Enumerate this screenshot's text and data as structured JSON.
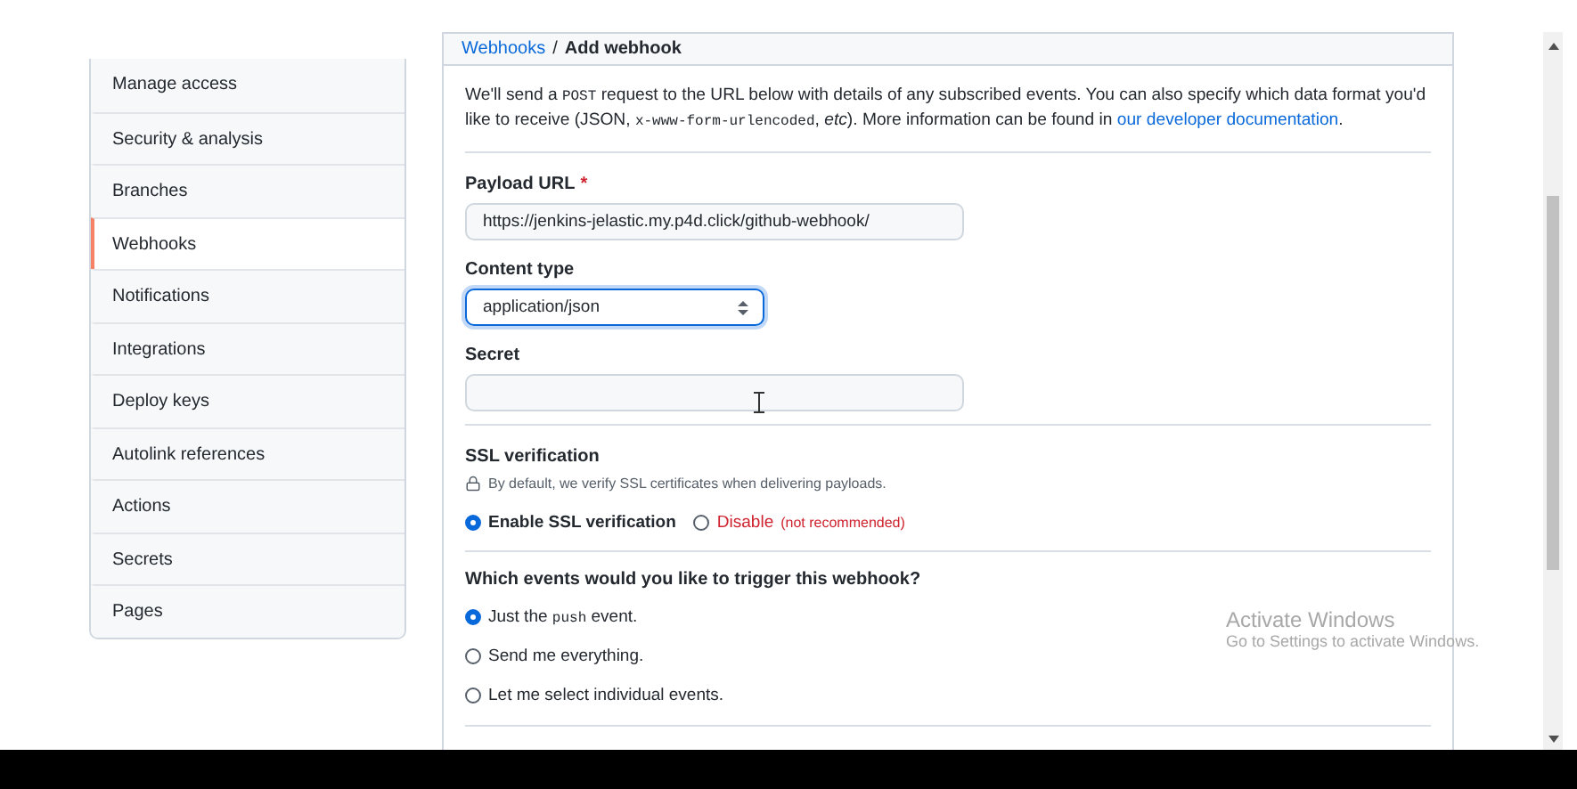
{
  "sidebar": {
    "items": [
      {
        "label": "Manage access",
        "selected": false
      },
      {
        "label": "Security & analysis",
        "selected": false
      },
      {
        "label": "Branches",
        "selected": false
      },
      {
        "label": "Webhooks",
        "selected": true
      },
      {
        "label": "Notifications",
        "selected": false
      },
      {
        "label": "Integrations",
        "selected": false
      },
      {
        "label": "Deploy keys",
        "selected": false
      },
      {
        "label": "Autolink references",
        "selected": false
      },
      {
        "label": "Actions",
        "selected": false
      },
      {
        "label": "Secrets",
        "selected": false
      },
      {
        "label": "Pages",
        "selected": false
      }
    ]
  },
  "breadcrumb": [
    {
      "label": "Webhooks",
      "kind": "link"
    },
    {
      "label": "/",
      "kind": "separator"
    },
    {
      "label": "Add webhook",
      "kind": "current"
    }
  ],
  "intro": [
    {
      "kind": "text",
      "text": "We'll send a "
    },
    {
      "kind": "code",
      "text": "POST"
    },
    {
      "kind": "text",
      "text": " request to the URL below with details of any subscribed events. You can also specify which data format you'd like to receive ("
    },
    {
      "kind": "text",
      "text": "JSON, "
    },
    {
      "kind": "code",
      "text": "x-www-form-urlencoded"
    },
    {
      "kind": "text",
      "text": ", "
    },
    {
      "kind": "em",
      "text": "etc"
    },
    {
      "kind": "text",
      "text": "). More information can be found in "
    },
    {
      "kind": "link",
      "text": "our developer documentation"
    },
    {
      "kind": "text",
      "text": "."
    }
  ],
  "payload_url": {
    "label": "Payload URL",
    "required_mark": "*",
    "value": "https://jenkins-jelastic.my.p4d.click/github-webhook/"
  },
  "content_type": {
    "label": "Content type",
    "value": "application/json",
    "focused": true
  },
  "secret": {
    "label": "Secret"
  },
  "ssl": {
    "heading": "SSL verification",
    "note": "By default, we verify SSL certificates when delivering payloads.",
    "options": [
      {
        "kind": "plain",
        "label": "Enable SSL verification",
        "selected": true
      },
      {
        "kind": "danger",
        "label": "Disable",
        "hint": "(not recommended)",
        "selected": false
      }
    ]
  },
  "events": {
    "question": "Which events would you like to trigger this webhook?",
    "options": [
      {
        "selected": true,
        "segments": [
          {
            "kind": "text",
            "text": "Just the "
          },
          {
            "kind": "code",
            "text": "push"
          },
          {
            "kind": "text",
            "text": " event."
          }
        ]
      },
      {
        "selected": false,
        "segments": [
          {
            "kind": "text",
            "text": "Send me everything."
          }
        ]
      },
      {
        "selected": false,
        "segments": [
          {
            "kind": "text",
            "text": "Let me select individual events."
          }
        ]
      }
    ]
  },
  "os_notice": {
    "title": "Activate Windows",
    "message": "Go to Settings to activate Windows."
  }
}
